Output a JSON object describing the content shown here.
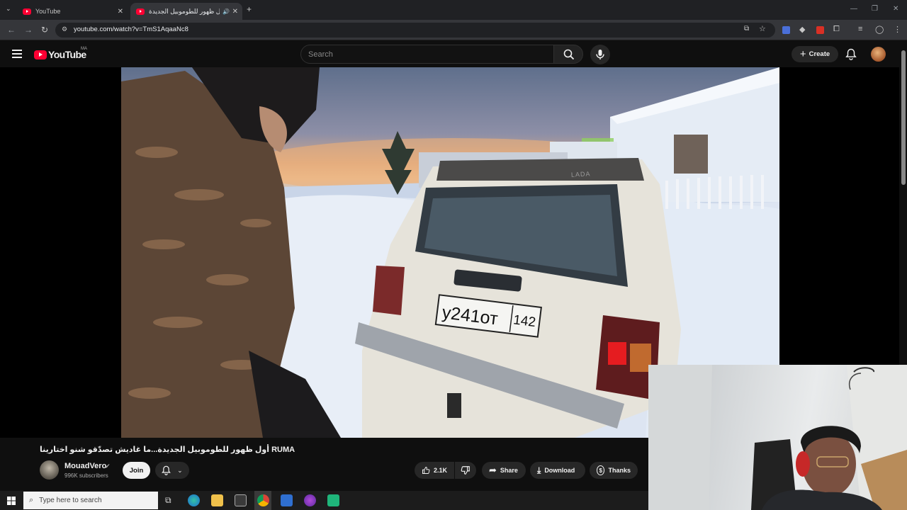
{
  "browser": {
    "tabs": [
      {
        "title": "YouTube",
        "active": false
      },
      {
        "title": "أول ظهور للطوموبيل الجديدة",
        "active": true
      }
    ],
    "url": "youtube.com/watch?v=TmS1AqaaNc8"
  },
  "youtube": {
    "logo_text": "YouTube",
    "country_code": "MA",
    "search_placeholder": "Search",
    "create_label": "Create"
  },
  "video": {
    "plate_text": "у241от",
    "plate_region": "142",
    "car_brand": "LADA",
    "title": "أول ظهور للطوموبيل الجديدة...ما غاديش تصدّقو شنو اختارينا RUMA",
    "channel": {
      "name": "MouadVero",
      "subscribers": "996K subscribers",
      "join_label": "Join"
    },
    "actions": {
      "likes": "2.1K",
      "share": "Share",
      "download": "Download",
      "thanks": "Thanks"
    }
  },
  "taskbar": {
    "search_placeholder": "Type here to search"
  },
  "colors": {
    "youtube_red": "#ff0033",
    "background": "#0f0f0f"
  }
}
